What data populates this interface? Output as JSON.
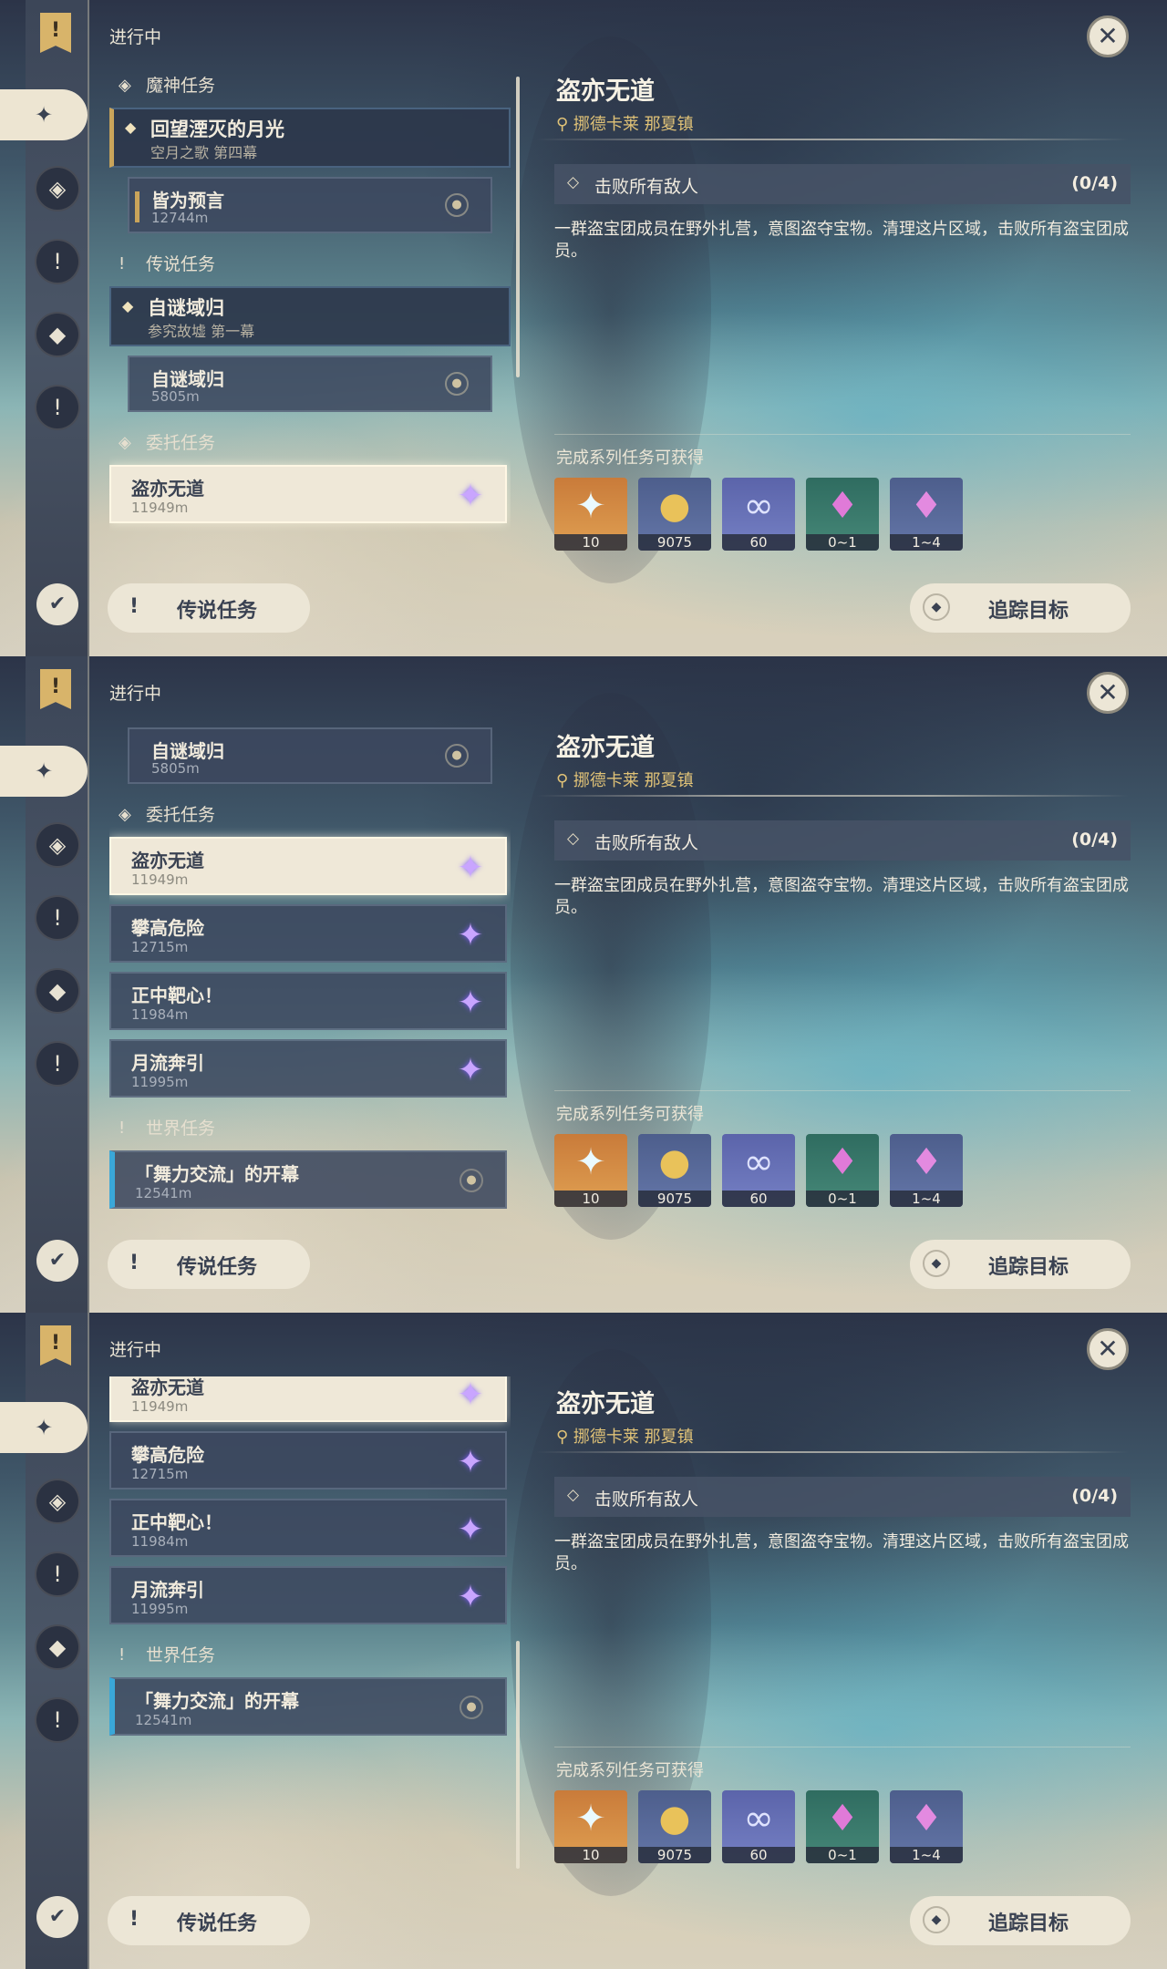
{
  "status_label": "进行中",
  "categories": {
    "archon": "魔神任务",
    "legend": "传说任务",
    "commission": "委托任务",
    "world": "世界任务"
  },
  "archon_quest": {
    "title": "回望湮灭的月光",
    "chapter": "空月之歌 第四幕"
  },
  "archon_sub": {
    "title": "皆为预言",
    "distance": "12744m"
  },
  "legend_quest": {
    "title": "自谜域归",
    "chapter": "参究故墟 第一幕"
  },
  "legend_sub": {
    "title": "自谜域归",
    "distance": "5805m"
  },
  "commissions": [
    {
      "title": "盗亦无道",
      "distance": "11949m"
    },
    {
      "title": "攀高危险",
      "distance": "12715m"
    },
    {
      "title": "正中靶心！",
      "distance": "11984m"
    },
    {
      "title": "月流奔引",
      "distance": "11995m"
    }
  ],
  "world_quest": {
    "title": "「舞力交流」的开幕",
    "distance": "12541m"
  },
  "legend_button": "传说任务",
  "track_button": "追踪目标",
  "detail": {
    "title": "盗亦无道",
    "location": "挪德卡莱 那夏镇",
    "objective": "击败所有敌人",
    "objective_count": "(0/4)",
    "description": "一群盗宝团成员在野外扎营，意图盗夺宝物。清理这片区域，击败所有盗宝团成员。",
    "rewards_label": "完成系列任务可获得",
    "rewards": [
      {
        "name": "primogem-icon",
        "qty": "10",
        "color": "#d88a3a"
      },
      {
        "name": "mora-icon",
        "qty": "9075",
        "color": "#5a6fa0"
      },
      {
        "name": "friendship-icon",
        "qty": "60",
        "color": "#6a74b8"
      },
      {
        "name": "crystal-small-icon",
        "qty": "0~1",
        "color": "#3f7a6c"
      },
      {
        "name": "crystal-large-icon",
        "qty": "1~4",
        "color": "#5a6fa0"
      }
    ]
  },
  "colors": {
    "rail": "#4a5566",
    "cream": "#ece6d6",
    "gold": "#c9a45a",
    "world_blue": "#3aa7d8",
    "star_purple": "#c9a5ff"
  }
}
